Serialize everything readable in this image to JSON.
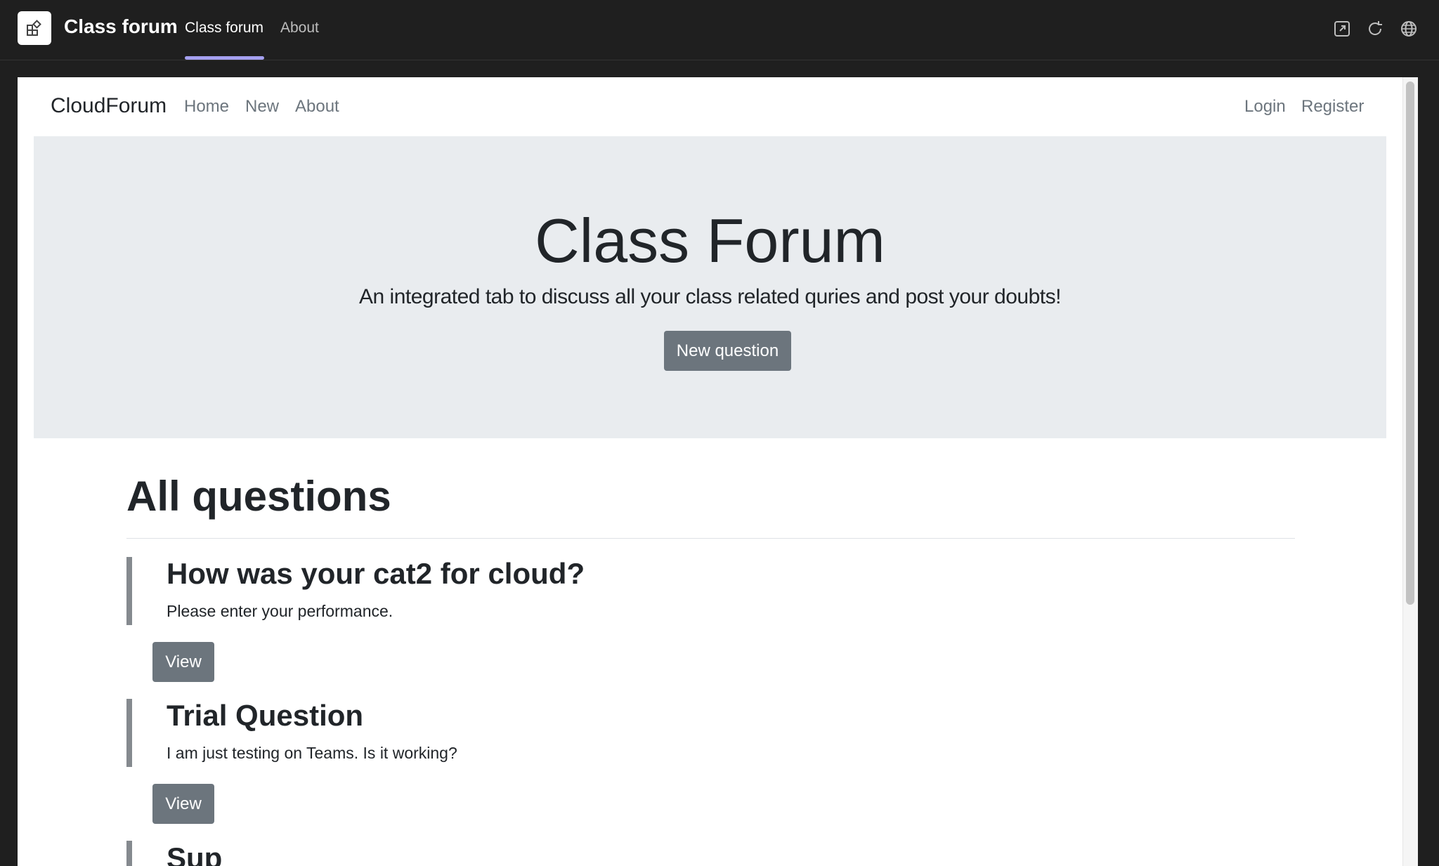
{
  "teams": {
    "app_title": "Class forum",
    "tabs": [
      {
        "label": "Class forum",
        "active": true
      },
      {
        "label": "About",
        "active": false
      }
    ],
    "accent_color": "#a5a0f0",
    "icons": [
      "popout-icon",
      "refresh-icon",
      "globe-icon"
    ]
  },
  "site": {
    "brand": "CloudForum",
    "nav": {
      "home": "Home",
      "new": "New",
      "about": "About",
      "login": "Login",
      "register": "Register"
    },
    "hero": {
      "title": "Class Forum",
      "lead": "An integrated tab to discuss all your class related quries and post your doubts!",
      "button": "New question"
    },
    "section_title": "All questions",
    "questions": [
      {
        "title": "How was your cat2 for cloud?",
        "body": "Please enter your performance.",
        "button": "View"
      },
      {
        "title": "Trial Question",
        "body": "I am just testing on Teams. Is it working?",
        "button": "View"
      },
      {
        "title": "Sup",
        "body": "",
        "button": ""
      }
    ]
  }
}
